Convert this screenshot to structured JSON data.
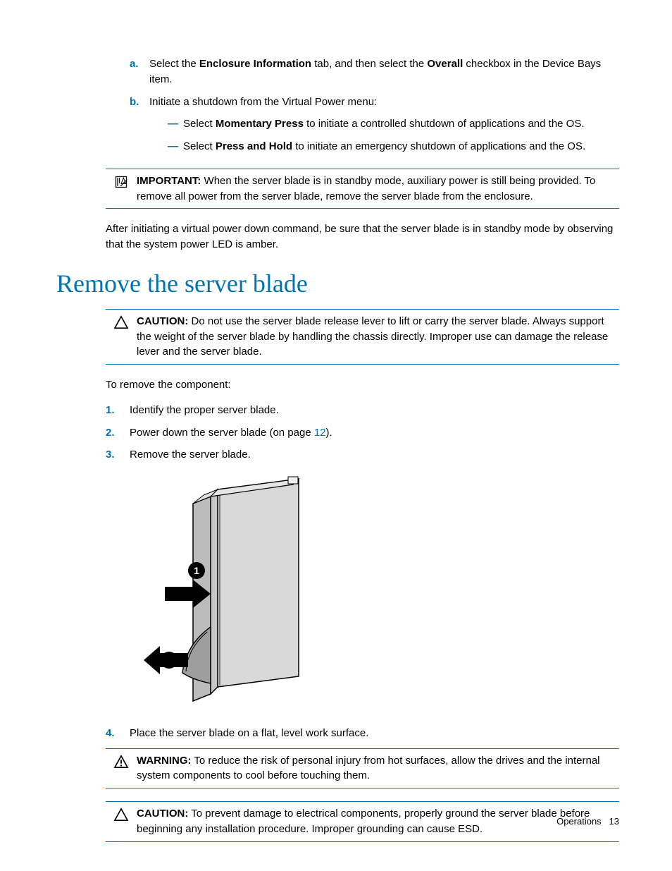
{
  "alpha_list": [
    {
      "marker": "a.",
      "pre": "Select the ",
      "bold1": "Enclosure Information",
      "mid": " tab, and then select the ",
      "bold2": "Overall",
      "post": " checkbox in the Device Bays item."
    },
    {
      "marker": "b.",
      "text": "Initiate a shutdown from the Virtual Power menu:"
    }
  ],
  "dash_list": [
    {
      "pre": "Select ",
      "bold": "Momentary Press",
      "post": " to initiate a controlled shutdown of applications and the OS."
    },
    {
      "pre": "Select ",
      "bold": "Press and Hold",
      "post": " to initiate an emergency shutdown of applications and the OS."
    }
  ],
  "important": {
    "label": "IMPORTANT:",
    "text": "   When the server blade is in standby mode, auxiliary power is still being provided. To remove all power from the server blade, remove the server blade from the enclosure."
  },
  "after_para": "After initiating a virtual power down command, be sure that the server blade is in standby mode by observing that the system power LED is amber.",
  "section_heading": "Remove the server blade",
  "caution1": {
    "label": "CAUTION:",
    "text": "   Do not use the server blade release lever to lift or carry the server blade. Always support the weight of the server blade by handling the chassis directly. Improper use can damage the release lever and the server blade."
  },
  "remove_intro": "To remove the component:",
  "num_list": {
    "1": "Identify the proper server blade.",
    "2_pre": "Power down the server blade (on page ",
    "2_link": "12",
    "2_post": ").",
    "3": "Remove the server blade.",
    "4": "Place the server blade on a flat, level work surface."
  },
  "warning": {
    "label": "WARNING:",
    "text": "   To reduce the risk of personal injury from hot surfaces, allow the drives and the internal system components to cool before touching them."
  },
  "caution2": {
    "label": "CAUTION:",
    "text": "   To prevent damage to electrical components, properly ground the server blade before beginning any installation procedure. Improper grounding can cause ESD."
  },
  "footer": {
    "section": "Operations",
    "page": "13"
  }
}
